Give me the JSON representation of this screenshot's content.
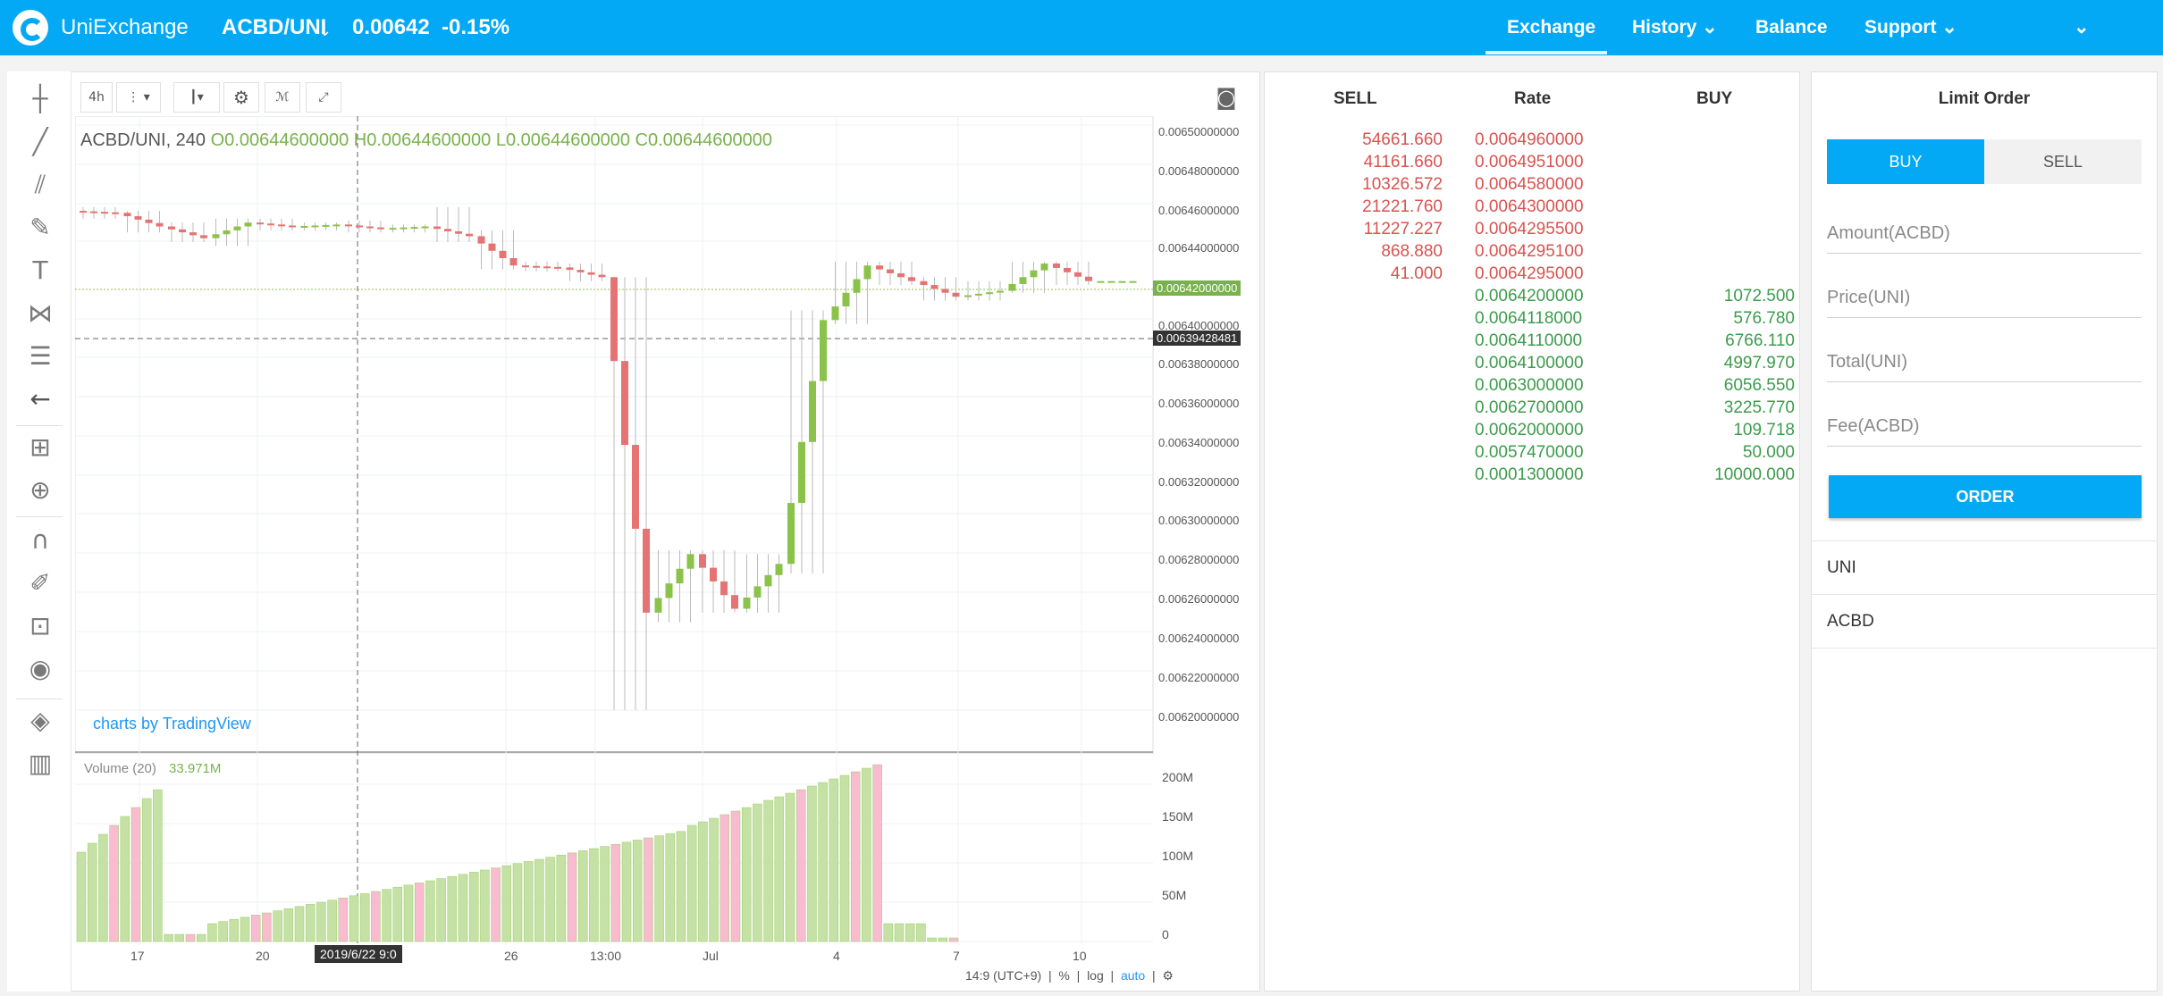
{
  "header": {
    "brand": "UniExchange",
    "pair": "ACBD/UNI",
    "pair_caret": "⌄",
    "price": "0.00642",
    "change": "-0.15%",
    "nav": [
      {
        "label": "Exchange",
        "active": true
      },
      {
        "label": "History ⌄"
      },
      {
        "label": "Balance"
      },
      {
        "label": "Support ⌄"
      },
      {
        "label": "⌄"
      }
    ],
    "colors": {
      "bar": "#03a9f4",
      "text": "#ffffff"
    }
  },
  "chart": {
    "toolbar": {
      "interval": "4h"
    },
    "legend": {
      "symbol": "ACBD/UNI, 240",
      "o": "O0.00644600000",
      "h": "H0.00644600000",
      "l": "L0.00644600000",
      "c": "C0.00644600000"
    },
    "volume_legend": {
      "label": "Volume (20)",
      "value": "33.971M"
    },
    "branding": "charts by TradingView",
    "price_labels": [
      "0.00650000000",
      "0.00648000000",
      "0.00646000000",
      "0.00644000000",
      "0.00640000000",
      "0.00638000000",
      "0.00636000000",
      "0.00634000000",
      "0.00632000000",
      "0.00630000000",
      "0.00628000000",
      "0.00626000000",
      "0.00624000000",
      "0.00622000000",
      "0.00620000000"
    ],
    "current_price_label": "0.00642000000",
    "cursor_price_label": "0.00639428481",
    "volume_labels": [
      "200M",
      "150M",
      "100M",
      "50M",
      "0"
    ],
    "x_labels": [
      "17",
      "20",
      "26",
      "13:00",
      "Jul",
      "4",
      "7",
      "10"
    ],
    "x_cursor_label": "2019/6/22 9:0",
    "footer": {
      "time": "14:9 (UTC+9)",
      "percent": "%",
      "log": "log",
      "auto": "auto"
    },
    "colors": {
      "up": "#8bc34a",
      "down": "#e57373",
      "vol_up": "#c5e1a5",
      "vol_down": "#f8bbd0"
    }
  },
  "chart_data": {
    "type": "candlestick",
    "ohlc_sample": [
      [
        0.006456,
        0.006458,
        0.006452,
        0.006455
      ],
      [
        0.006455,
        0.006456,
        0.006445,
        0.006448
      ],
      [
        0.006448,
        0.00645,
        0.00644,
        0.006442
      ],
      [
        0.006442,
        0.006452,
        0.006438,
        0.00645
      ],
      [
        0.00645,
        0.006452,
        0.006446,
        0.006448
      ],
      [
        0.006448,
        0.00645,
        0.006446,
        0.006449
      ],
      [
        0.006449,
        0.006451,
        0.006445,
        0.006447
      ],
      [
        0.006447,
        0.006449,
        0.006445,
        0.006448
      ],
      [
        0.006448,
        0.006458,
        0.00644,
        0.006443
      ],
      [
        0.006443,
        0.006446,
        0.006426,
        0.006428
      ],
      [
        0.006428,
        0.00643,
        0.006425,
        0.006427
      ],
      [
        0.006427,
        0.006429,
        0.00642,
        0.006422
      ],
      [
        0.006422,
        0.006422,
        0.0062,
        0.00625
      ],
      [
        0.00625,
        0.006282,
        0.006245,
        0.00628
      ],
      [
        0.00628,
        0.006282,
        0.00625,
        0.006252
      ],
      [
        0.006252,
        0.00628,
        0.00625,
        0.006275
      ],
      [
        0.006275,
        0.006405,
        0.00627,
        0.0064
      ],
      [
        0.0064,
        0.00643,
        0.006398,
        0.006428
      ],
      [
        0.006428,
        0.00643,
        0.006418,
        0.00642
      ],
      [
        0.00642,
        0.006422,
        0.00641,
        0.006412
      ],
      [
        0.006412,
        0.00642,
        0.00641,
        0.006415
      ],
      [
        0.006415,
        0.00643,
        0.006414,
        0.006429
      ],
      [
        0.006429,
        0.00643,
        0.006418,
        0.00642
      ],
      [
        0.00642,
        0.00642,
        0.00642,
        0.00642
      ]
    ],
    "volume_unit": "M"
  },
  "orderbook": {
    "headers": {
      "sell": "SELL",
      "rate": "Rate",
      "buy": "BUY"
    },
    "asks": [
      {
        "amount": "54661.660",
        "rate": "0.0064960000"
      },
      {
        "amount": "41161.660",
        "rate": "0.0064951000"
      },
      {
        "amount": "10326.572",
        "rate": "0.0064580000"
      },
      {
        "amount": "21221.760",
        "rate": "0.0064300000"
      },
      {
        "amount": "11227.227",
        "rate": "0.0064295500"
      },
      {
        "amount": "868.880",
        "rate": "0.0064295100"
      },
      {
        "amount": "41.000",
        "rate": "0.0064295000"
      }
    ],
    "bids": [
      {
        "rate": "0.0064200000",
        "amount": "1072.500"
      },
      {
        "rate": "0.0064118000",
        "amount": "576.780"
      },
      {
        "rate": "0.0064110000",
        "amount": "6766.110"
      },
      {
        "rate": "0.0064100000",
        "amount": "4997.970"
      },
      {
        "rate": "0.0063000000",
        "amount": "6056.550"
      },
      {
        "rate": "0.0062700000",
        "amount": "3225.770"
      },
      {
        "rate": "0.0062000000",
        "amount": "109.718"
      },
      {
        "rate": "0.0057470000",
        "amount": "50.000"
      },
      {
        "rate": "0.0001300000",
        "amount": "10000.000"
      }
    ],
    "colors": {
      "ask": "#d9534f",
      "bid": "#3c9c4c"
    }
  },
  "limit_order": {
    "title": "Limit Order",
    "buy_label": "BUY",
    "sell_label": "SELL",
    "amount_placeholder": "Amount(ACBD)",
    "price_placeholder": "Price(UNI)",
    "total_placeholder": "Total(UNI)",
    "fee_placeholder": "Fee(ACBD)",
    "order_label": "ORDER",
    "balances": [
      "UNI",
      "ACBD"
    ]
  }
}
